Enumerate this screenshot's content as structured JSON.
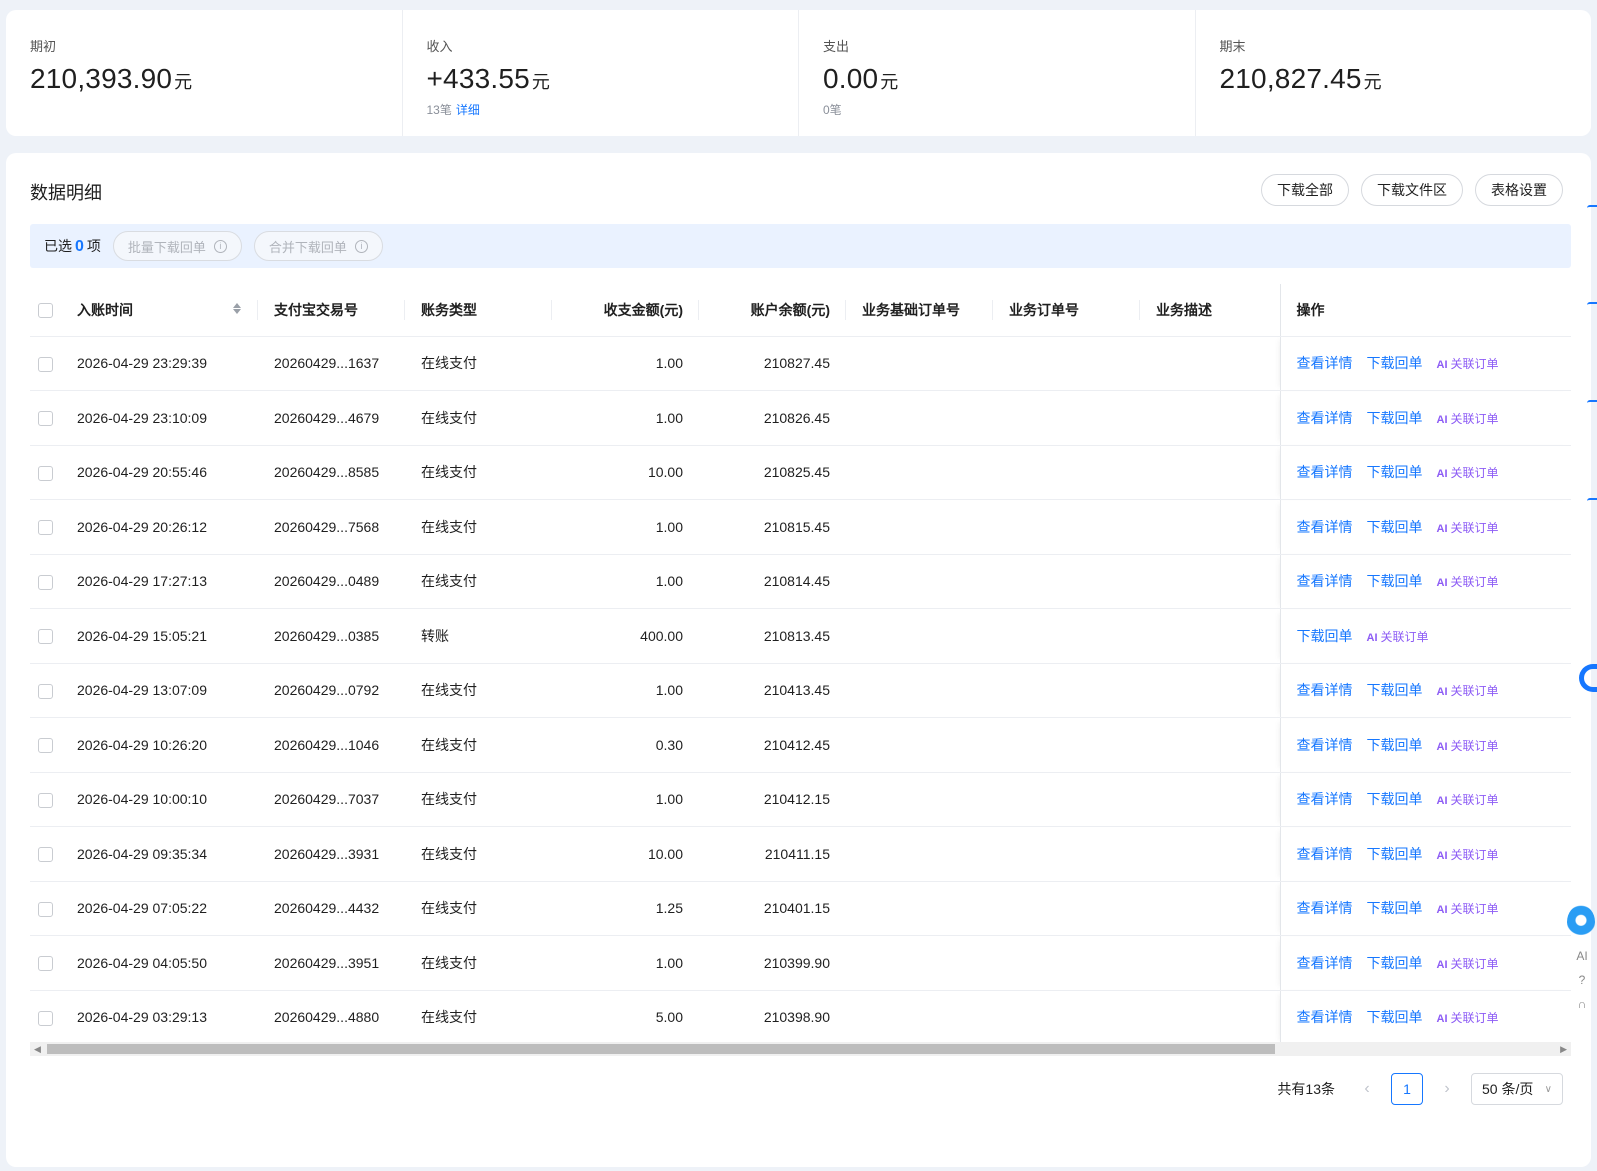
{
  "summary": [
    {
      "label": "期初",
      "value": "210,393.90",
      "unit": "元",
      "count": "",
      "detail": ""
    },
    {
      "label": "收入",
      "value": "+433.55",
      "unit": "元",
      "count": "13笔",
      "detail": "详细"
    },
    {
      "label": "支出",
      "value": "0.00",
      "unit": "元",
      "count": "0笔",
      "detail": ""
    },
    {
      "label": "期末",
      "value": "210,827.45",
      "unit": "元",
      "count": "",
      "detail": ""
    }
  ],
  "panel": {
    "title": "数据明细",
    "actions": [
      "下载全部",
      "下载文件区",
      "表格设置"
    ]
  },
  "selection": {
    "prefix": "已选",
    "count": "0",
    "suffix": "项",
    "batch_download": "批量下载回单",
    "merge_download": "合并下载回单"
  },
  "table": {
    "columns": [
      "入账时间",
      "支付宝交易号",
      "账务类型",
      "收支金额(元)",
      "账户余额(元)",
      "业务基础订单号",
      "业务订单号",
      "业务描述",
      "操作"
    ],
    "op_labels": {
      "view": "查看详情",
      "download": "下载回单",
      "link": "关联订单",
      "ai": "AI"
    },
    "rows": [
      {
        "time": "2026-04-29 23:29:39",
        "txn": "20260429...1637",
        "type": "在线支付",
        "amount": "1.00",
        "balance": "210827.45",
        "has_view": true
      },
      {
        "time": "2026-04-29 23:10:09",
        "txn": "20260429...4679",
        "type": "在线支付",
        "amount": "1.00",
        "balance": "210826.45",
        "has_view": true
      },
      {
        "time": "2026-04-29 20:55:46",
        "txn": "20260429...8585",
        "type": "在线支付",
        "amount": "10.00",
        "balance": "210825.45",
        "has_view": true
      },
      {
        "time": "2026-04-29 20:26:12",
        "txn": "20260429...7568",
        "type": "在线支付",
        "amount": "1.00",
        "balance": "210815.45",
        "has_view": true
      },
      {
        "time": "2026-04-29 17:27:13",
        "txn": "20260429...0489",
        "type": "在线支付",
        "amount": "1.00",
        "balance": "210814.45",
        "has_view": true
      },
      {
        "time": "2026-04-29 15:05:21",
        "txn": "20260429...0385",
        "type": "转账",
        "amount": "400.00",
        "balance": "210813.45",
        "has_view": false
      },
      {
        "time": "2026-04-29 13:07:09",
        "txn": "20260429...0792",
        "type": "在线支付",
        "amount": "1.00",
        "balance": "210413.45",
        "has_view": true
      },
      {
        "time": "2026-04-29 10:26:20",
        "txn": "20260429...1046",
        "type": "在线支付",
        "amount": "0.30",
        "balance": "210412.45",
        "has_view": true
      },
      {
        "time": "2026-04-29 10:00:10",
        "txn": "20260429...7037",
        "type": "在线支付",
        "amount": "1.00",
        "balance": "210412.15",
        "has_view": true
      },
      {
        "time": "2026-04-29 09:35:34",
        "txn": "20260429...3931",
        "type": "在线支付",
        "amount": "10.00",
        "balance": "210411.15",
        "has_view": true
      },
      {
        "time": "2026-04-29 07:05:22",
        "txn": "20260429...4432",
        "type": "在线支付",
        "amount": "1.25",
        "balance": "210401.15",
        "has_view": true
      },
      {
        "time": "2026-04-29 04:05:50",
        "txn": "20260429...3951",
        "type": "在线支付",
        "amount": "1.00",
        "balance": "210399.90",
        "has_view": true
      },
      {
        "time": "2026-04-29 03:29:13",
        "txn": "20260429...4880",
        "type": "在线支付",
        "amount": "5.00",
        "balance": "210398.90",
        "has_view": true
      }
    ]
  },
  "pagination": {
    "total": "共有13条",
    "current": "1",
    "page_size": "50 条/页"
  },
  "side": {
    "ai": "AI"
  },
  "colors": {
    "primary": "#1677ff",
    "ai_purple": "#8d5cf5"
  }
}
